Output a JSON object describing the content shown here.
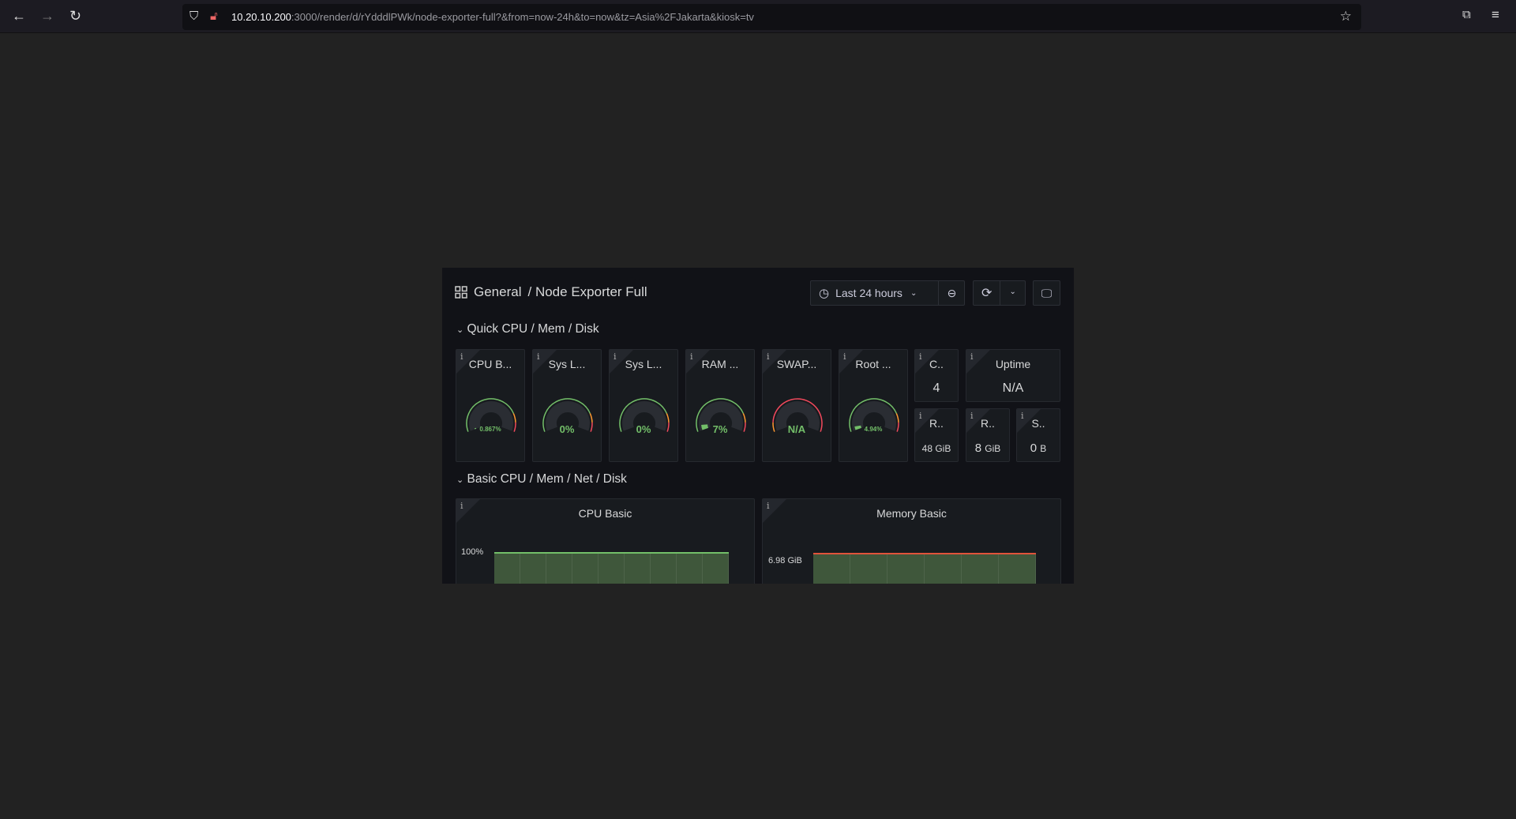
{
  "browser": {
    "url_host": "10.20.10.200",
    "url_rest": ":3000/render/d/rYdddlPWk/node-exporter-full?&from=now-24h&to=now&tz=Asia%2FJakarta&kiosk=tv"
  },
  "header": {
    "breadcrumb_root": "General",
    "breadcrumb_sep": "/",
    "dashboard_title": "Node Exporter Full",
    "time_range": "Last 24 hours"
  },
  "rows": [
    {
      "title": "Quick CPU / Mem / Disk"
    },
    {
      "title": "Basic CPU / Mem / Net / Disk"
    }
  ],
  "gauges": [
    {
      "title": "CPU B...",
      "value": "0.867%",
      "percent": 0.867,
      "status": "ok"
    },
    {
      "title": "Sys L...",
      "value": "0%",
      "percent": 0,
      "status": "ok"
    },
    {
      "title": "Sys L...",
      "value": "0%",
      "percent": 0,
      "status": "ok"
    },
    {
      "title": "RAM ...",
      "value": "7%",
      "percent": 7,
      "status": "ok"
    },
    {
      "title": "SWAP...",
      "value": "N/A",
      "percent": null,
      "status": "na"
    },
    {
      "title": "Root ...",
      "value": "4.94%",
      "percent": 4.94,
      "status": "ok"
    }
  ],
  "stats": [
    {
      "title": "C..",
      "value": "4"
    },
    {
      "title": "Uptime",
      "value": "N/A"
    },
    {
      "title": "R..",
      "value": "48",
      "unit": "GiB"
    },
    {
      "title": "R..",
      "value": "8",
      "unit": "GiB"
    },
    {
      "title": "S..",
      "value": "0",
      "unit": "B"
    }
  ],
  "charts": [
    {
      "title": "CPU Basic",
      "y_tick": "100%"
    },
    {
      "title": "Memory Basic",
      "y_tick": "6.98 GiB"
    }
  ],
  "colors": {
    "green": "#73bf69",
    "red": "#f2495c",
    "orange": "#ff9830",
    "fill": "#3f573b"
  }
}
